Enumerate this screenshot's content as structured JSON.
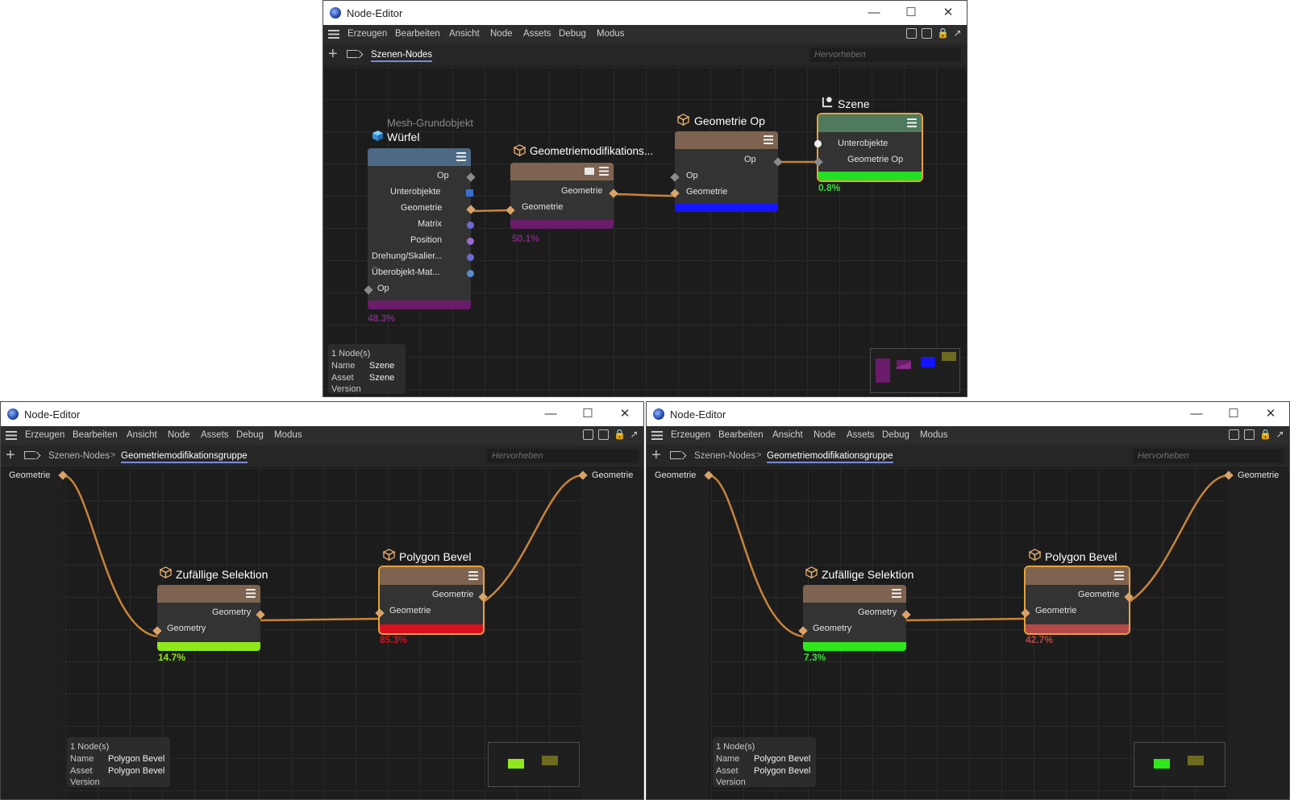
{
  "windows": [
    {
      "title": "Node-Editor",
      "menu": [
        "Erzeugen",
        "Bearbeiten",
        "Ansicht",
        "Node",
        "Assets",
        "Debug",
        "Modus"
      ],
      "breadcrumbs": [
        "Szenen-Nodes"
      ],
      "search_placeholder": "Hervorheben",
      "nodes": {
        "mesh": {
          "subtitle": "Mesh-Grundobjekt",
          "title": "Würfel",
          "header_color": "#4d6a84",
          "footer_color": "#6a1b6a",
          "outputs": [
            "Op",
            "Unterobjekte",
            "Geometrie",
            "Matrix",
            "Position",
            "Drehung/Skalier...",
            "Überobjekt-Mat..."
          ],
          "input": "Op",
          "percent": "48.3%",
          "percent_color": "#7a2a7a"
        },
        "geomod": {
          "title": "Geometriemodifikations...",
          "header_color": "#7d6350",
          "footer_color": "#6a1b6a",
          "output": "Geometrie",
          "input": "Geometrie",
          "percent": "50.1%",
          "percent_color": "#7a2a7a"
        },
        "geomop": {
          "title": "Geometrie Op",
          "header_color": "#7d6350",
          "footer_color": "#1414ff",
          "output": "Op",
          "inputs": [
            "Op",
            "Geometrie"
          ]
        },
        "szene": {
          "title": "Szene",
          "header_color": "#4f7a5d",
          "footer_color": "#22e022",
          "ports": [
            "Unterobjekte",
            "Geometrie Op"
          ],
          "percent": "0.8%",
          "percent_color": "#3ae03a"
        }
      },
      "info": {
        "count": "1 Node(s)",
        "name_label": "Name",
        "name": "Szene",
        "asset_label": "Asset",
        "asset": "Szene",
        "version_label": "Version"
      }
    },
    {
      "title": "Node-Editor",
      "menu": [
        "Erzeugen",
        "Bearbeiten",
        "Ansicht",
        "Node",
        "Assets",
        "Debug",
        "Modus"
      ],
      "breadcrumbs": [
        "Szenen-Nodes",
        "Geometriemodifikationsgruppe"
      ],
      "search_placeholder": "Hervorheben",
      "io_in": "Geometrie",
      "io_out": "Geometrie",
      "nodes": {
        "zufall": {
          "title": "Zufällige Selektion",
          "output": "Geometry",
          "input": "Geometry",
          "percent": "14.7%",
          "footer_color": "#8ee81c",
          "percent_color": "#8ee81c"
        },
        "bevel": {
          "title": "Polygon Bevel",
          "output": "Geometrie",
          "input": "Geometrie",
          "percent": "85.3%",
          "footer_color": "#d8101e",
          "percent_color": "#d8101e"
        }
      },
      "info": {
        "count": "1 Node(s)",
        "name_label": "Name",
        "name": "Polygon Bevel",
        "asset_label": "Asset",
        "asset": "Polygon Bevel",
        "version_label": "Version"
      }
    },
    {
      "title": "Node-Editor",
      "menu": [
        "Erzeugen",
        "Bearbeiten",
        "Ansicht",
        "Node",
        "Assets",
        "Debug",
        "Modus"
      ],
      "breadcrumbs": [
        "Szenen-Nodes",
        "Geometriemodifikationsgruppe"
      ],
      "search_placeholder": "Hervorheben",
      "io_in": "Geometrie",
      "io_out": "Geometrie",
      "nodes": {
        "zufall": {
          "title": "Zufällige Selektion",
          "output": "Geometry",
          "input": "Geometry",
          "percent": "7.3%",
          "footer_color": "#2ee81c",
          "percent_color": "#3ae03a"
        },
        "bevel": {
          "title": "Polygon Bevel",
          "output": "Geometrie",
          "input": "Geometrie",
          "percent": "42.7%",
          "footer_color": "#b54848",
          "percent_color": "#c04848"
        }
      },
      "info": {
        "count": "1 Node(s)",
        "name_label": "Name",
        "name": "Polygon Bevel",
        "asset_label": "Asset",
        "asset": "Polygon Bevel",
        "version_label": "Version"
      }
    }
  ],
  "colors": {
    "wire": "#c8843a",
    "port_diamond": "#d9a36a",
    "port_gray": "#8a8a8a",
    "accent": "#7a8bd9"
  }
}
